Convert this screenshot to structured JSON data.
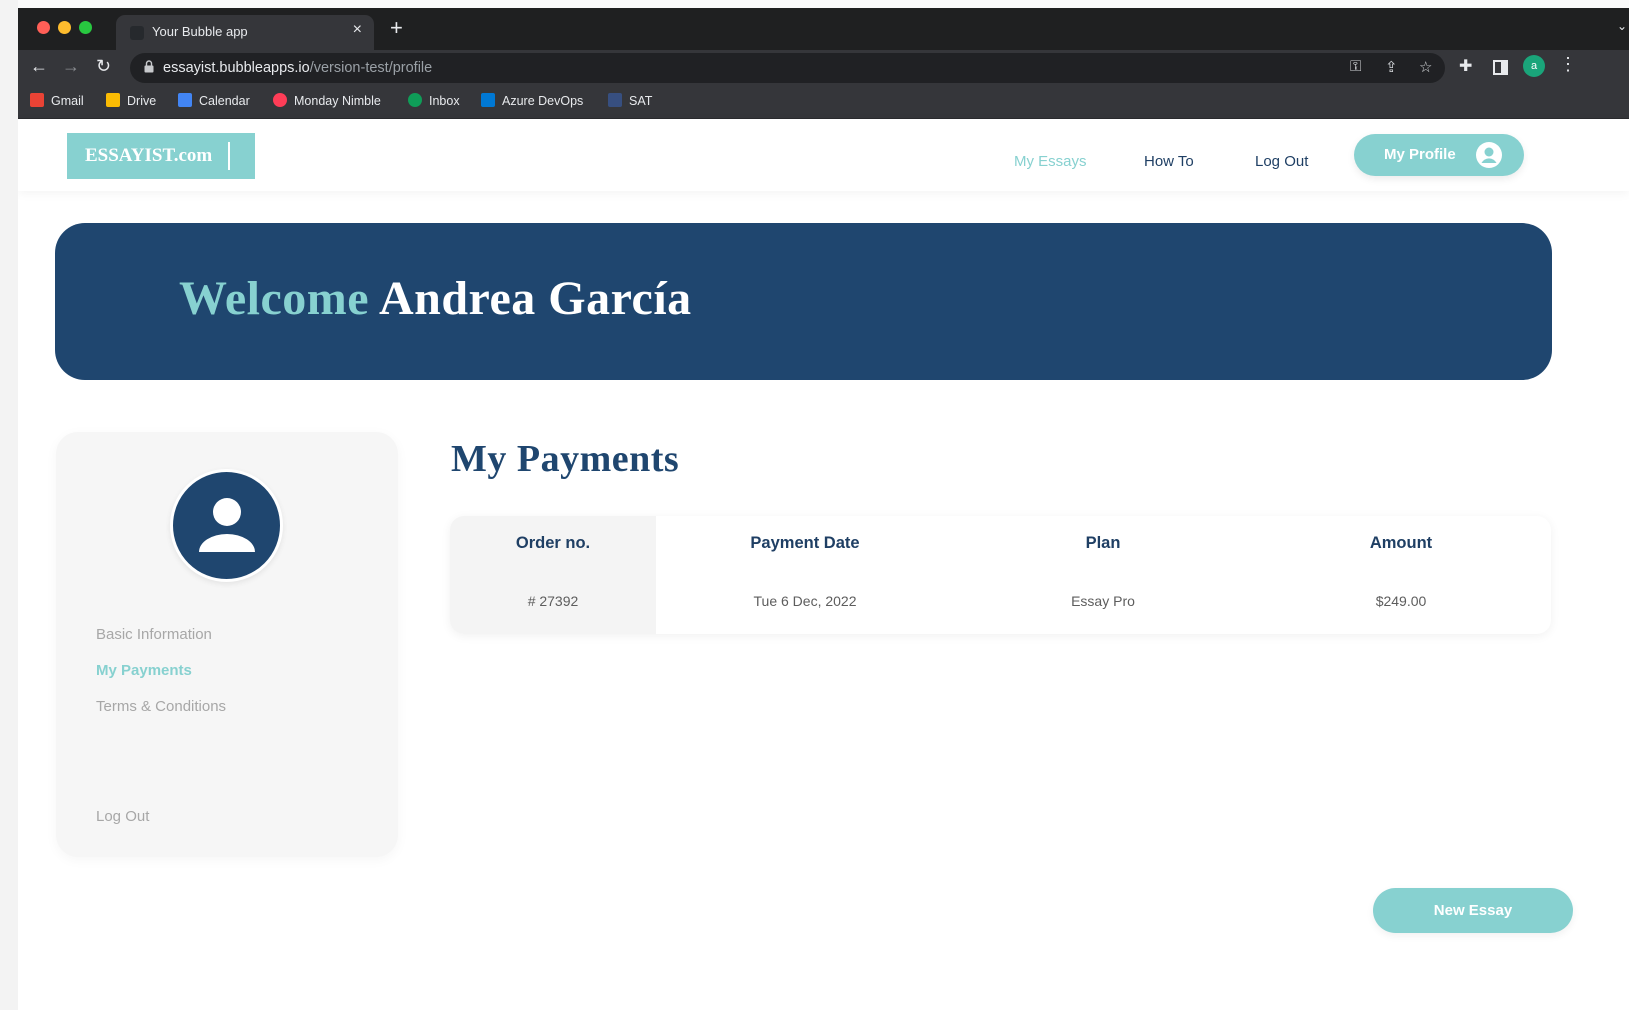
{
  "browser": {
    "tab_title": "Your Bubble app",
    "tab_close": "×",
    "new_tab": "+",
    "url_host": "essayist.bubbleapps.io",
    "url_path": "/version-test/profile",
    "account_initial": "a",
    "bookmarks": [
      {
        "label": "Gmail",
        "icon": "gmail-icon",
        "color": "#ea4335"
      },
      {
        "label": "Drive",
        "icon": "drive-icon",
        "color": "#fbbc04"
      },
      {
        "label": "Calendar",
        "icon": "calendar-icon",
        "color": "#4285f4"
      },
      {
        "label": "Monday Nimble",
        "icon": "monday-icon",
        "color": "#ff3d57"
      },
      {
        "label": "Inbox",
        "icon": "inbox-icon",
        "color": "#0f9d58"
      },
      {
        "label": "Azure DevOps",
        "icon": "azure-devops-icon",
        "color": "#0078d4"
      },
      {
        "label": "SAT",
        "icon": "sat-icon",
        "color": "#3a6fd8"
      }
    ]
  },
  "header": {
    "logo": "ESSAYIST.com",
    "nav": [
      "My Essays",
      "How To",
      "Log Out"
    ],
    "profile_button": "My Profile"
  },
  "banner": {
    "welcome": "Welcome",
    "name": "Andrea García"
  },
  "sidebar": {
    "items": [
      "Basic Information",
      "My Payments",
      "Terms & Conditions"
    ],
    "logout": "Log Out"
  },
  "payments": {
    "title": "My Payments",
    "headers": [
      "Order no.",
      "Payment Date",
      "Plan",
      "Amount"
    ],
    "row": [
      "# 27392",
      "Tue 6 Dec, 2022",
      "Essay Pro",
      "$249.00"
    ]
  },
  "actions": {
    "new_essay": "New Essay"
  },
  "colors": {
    "brand_teal": "#87d1d0",
    "brand_navy": "#1f466f",
    "chrome_dark": "#202124"
  }
}
